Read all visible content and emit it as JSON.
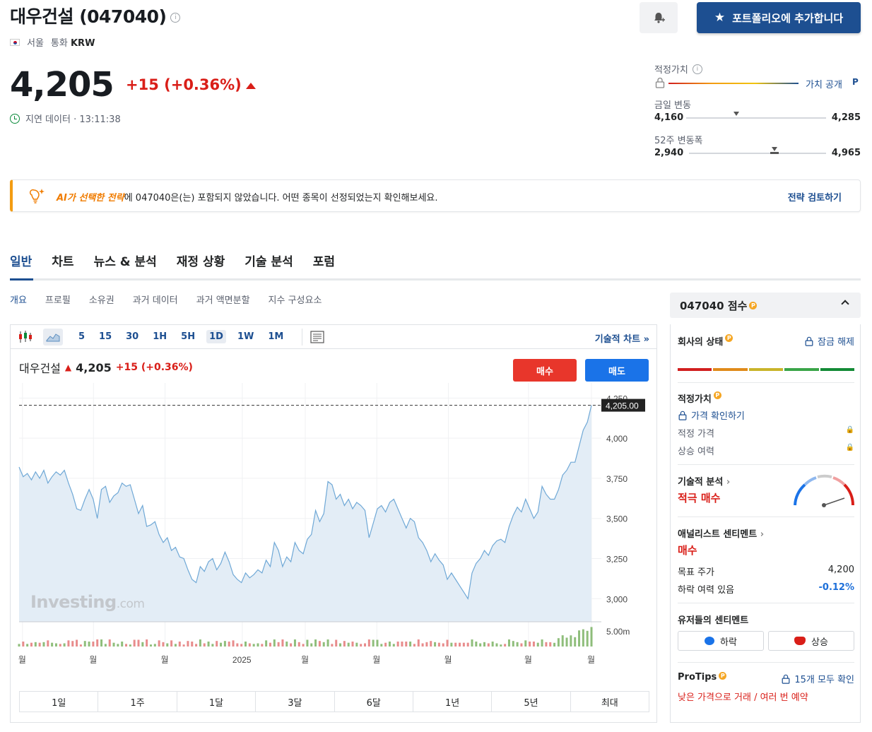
{
  "header": {
    "title": "대우건설 (047040)",
    "exchange": "서울",
    "currency_label": "통화",
    "currency": "KRW",
    "price": "4,205",
    "change": "+15 (+0.36%)",
    "delay_text": "지연 데이터 · 13:11:38",
    "portfolio_button": "포트폴리오에 추가합니다"
  },
  "summary": {
    "fair_value_label": "적정가치",
    "fair_value_link": "가치 공개",
    "day_range_label": "금일 변동",
    "day_low": "4,160",
    "day_high": "4,285",
    "week52_label": "52주 변동폭",
    "week52_low": "2,940",
    "week52_high": "4,965"
  },
  "banner": {
    "highlight": "AI가 선택한 전략",
    "text": "에 047040은(는) 포함되지 않았습니다. 어떤 종목이 선정되었는지 확인해보세요.",
    "link": "전략 검토하기"
  },
  "tabs": [
    "일반",
    "차트",
    "뉴스 & 분석",
    "재정 상황",
    "기술 분석",
    "포럼"
  ],
  "subtabs": [
    "개요",
    "프로필",
    "소유권",
    "과거 데이터",
    "과거 액면분할",
    "지수 구성요소"
  ],
  "chart_toolbar": {
    "timeframes": [
      "5",
      "15",
      "30",
      "1H",
      "5H",
      "1D",
      "1W",
      "1M"
    ],
    "selected": "1D",
    "tech_link": "기술적 차트 »"
  },
  "chart_header": {
    "name": "대우건설",
    "price": "4,205",
    "change": "+15 (+0.36%)",
    "buy": "매수",
    "sell": "매도",
    "watermark_brand": "Investing",
    "watermark_suffix": ".com"
  },
  "chart_data": {
    "type": "area",
    "y_ticks": [
      "4,250",
      "4,000",
      "3,750",
      "3,500",
      "3,250",
      "3,000"
    ],
    "y_tick_values": [
      4250,
      4000,
      3750,
      3500,
      3250,
      3000
    ],
    "ylim": [
      2900,
      4300
    ],
    "volume_tick": "5.00m",
    "current_label": "4,205.00",
    "current_value": 4205,
    "x_tick_labels": [
      "월",
      "월",
      "월",
      "2025",
      "월",
      "월",
      "월",
      "월",
      "월"
    ],
    "series": [
      {
        "values": [
          3820,
          3760,
          3780,
          3740,
          3790,
          3750,
          3800,
          3720,
          3760,
          3790,
          3770,
          3800,
          3720,
          3650,
          3560,
          3550,
          3620,
          3680,
          3620,
          3500,
          3680,
          3700,
          3600,
          3640,
          3660,
          3720,
          3700,
          3710,
          3620,
          3530,
          3580,
          3450,
          3460,
          3480,
          3400,
          3350,
          3380,
          3300,
          3320,
          3260,
          3250,
          3180,
          3120,
          3100,
          3200,
          3170,
          3230,
          3250,
          3180,
          3220,
          3290,
          3230,
          3150,
          3120,
          3100,
          3160,
          3130,
          3150,
          3180,
          3160,
          3240,
          3200,
          3350,
          3300,
          3200,
          3260,
          3230,
          3350,
          3300,
          3280,
          3370,
          3400,
          3550,
          3480,
          3530,
          3730,
          3710,
          3620,
          3650,
          3580,
          3620,
          3560,
          3600,
          3580,
          3550,
          3380,
          3470,
          3560,
          3580,
          3540,
          3600,
          3620,
          3560,
          3500,
          3440,
          3500,
          3480,
          3380,
          3350,
          3300,
          3230,
          3280,
          3240,
          3210,
          3120,
          3160,
          3120,
          3080,
          3040,
          3000,
          3160,
          3220,
          3250,
          3300,
          3270,
          3330,
          3360,
          3370,
          3350,
          3450,
          3520,
          3570,
          3540,
          3620,
          3560,
          3500,
          3540,
          3700,
          3650,
          3620,
          3620,
          3680,
          3770,
          3800,
          3850,
          3850,
          3950,
          4050,
          4100,
          4205
        ]
      }
    ],
    "volume_colors": [
      "#e06666",
      "#6aa84f"
    ]
  },
  "ranges": [
    "1일",
    "1주",
    "1달",
    "3달",
    "6달",
    "1년",
    "5년",
    "최대"
  ],
  "score_panel": {
    "title": "047040 점수",
    "company_health": "회사의 상태",
    "unlock": "잠금 해제",
    "fair_value": "적정가치",
    "price_check": "가격 확인하기",
    "fair_price": "적정 가격",
    "upside": "상승 여력",
    "tech_analysis": "기술적 분석",
    "tech_signal": "적극 매수",
    "analyst_sentiment": "애널리스트 센티멘트",
    "analyst_signal": "매수",
    "target_price_label": "목표 주가",
    "target_price": "4,200",
    "downside_label": "하락 여력 있음",
    "downside": "-0.12%",
    "user_sentiment": "유저들의 센티멘트",
    "bearish": "하락",
    "bullish": "상승",
    "protips": "ProTips",
    "protips_link": "15개 모두 확인",
    "protip_text": "낮은 가격으로 거래 / 여러 번 예약"
  },
  "colors": {
    "brand": "#1d4f91",
    "up": "#d91e18",
    "line": "#6fa8d6",
    "fill": "#e3edf6",
    "health_bars": [
      "#d11f1f",
      "#e08a1a",
      "#c9b42a",
      "#3aa548",
      "#138a36"
    ]
  }
}
